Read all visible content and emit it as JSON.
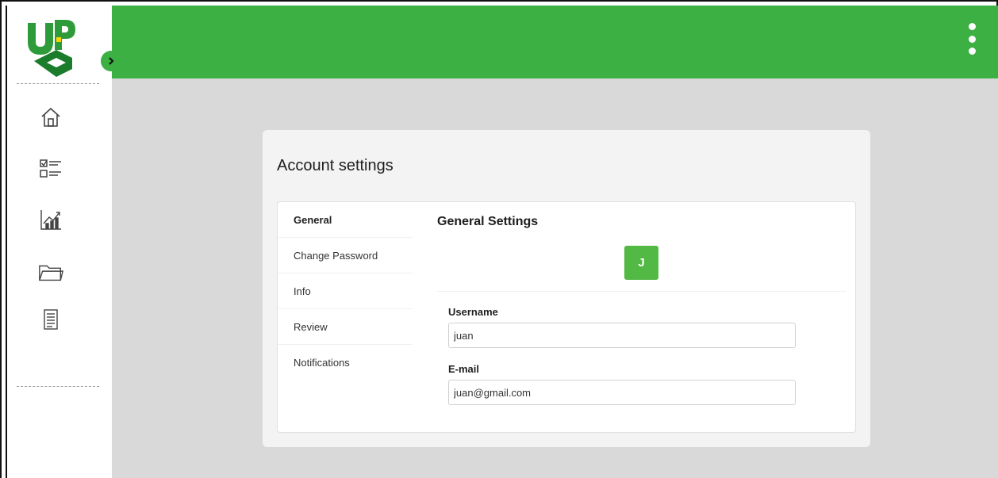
{
  "app": {
    "logo_text": "UPC",
    "expand_icon": "chevron-right-icon",
    "menu_icon": "kebab-menu-icon"
  },
  "sidebar": {
    "items": [
      {
        "name": "home",
        "icon": "home-icon"
      },
      {
        "name": "tasks",
        "icon": "checklist-icon"
      },
      {
        "name": "analytics",
        "icon": "chart-icon"
      },
      {
        "name": "files",
        "icon": "folder-icon"
      },
      {
        "name": "reports",
        "icon": "document-icon"
      }
    ]
  },
  "page": {
    "title": "Account settings"
  },
  "settings_menu": {
    "items": [
      {
        "label": "General",
        "active": true
      },
      {
        "label": "Change Password",
        "active": false
      },
      {
        "label": "Info",
        "active": false
      },
      {
        "label": "Review",
        "active": false
      },
      {
        "label": "Notifications",
        "active": false
      }
    ]
  },
  "general": {
    "title": "General Settings",
    "avatar_initial": "J",
    "username_label": "Username",
    "username_value": "juan",
    "email_label": "E-mail",
    "email_value": "juan@gmail.com"
  },
  "colors": {
    "brand_green": "#3cb043",
    "content_bg": "#d9d9d9"
  }
}
